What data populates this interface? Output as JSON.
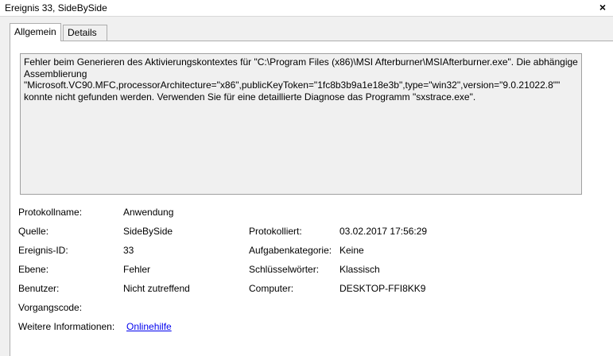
{
  "window": {
    "title": "Ereignis 33, SideBySide",
    "close_label": "×"
  },
  "tabs": [
    {
      "label": "Allgemein"
    },
    {
      "label": "Details"
    }
  ],
  "description": "Fehler beim Generieren des Aktivierungskontextes für \"C:\\Program Files (x86)\\MSI Afterburner\\MSIAfterburner.exe\". Die abhängige\nAssemblierung\n\"Microsoft.VC90.MFC,processorArchitecture=\"x86\",publicKeyToken=\"1fc8b3b9a1e18e3b\",type=\"win32\",version=\"9.0.21022.8\"\"\nkonnte nicht gefunden werden. Verwenden Sie für eine detaillierte Diagnose das Programm \"sxstrace.exe\".",
  "fields": {
    "protokollname": {
      "label": "Protokollname:",
      "value": "Anwendung"
    },
    "quelle": {
      "label": "Quelle:",
      "value": "SideBySide"
    },
    "protokolliert": {
      "label": "Protokolliert:",
      "value": "03.02.2017 17:56:29"
    },
    "ereignis_id": {
      "label": "Ereignis-ID:",
      "value": "33"
    },
    "aufgabenkategorie": {
      "label": "Aufgabenkategorie:",
      "value": "Keine"
    },
    "ebene": {
      "label": "Ebene:",
      "value": "Fehler"
    },
    "schluesselwoerter": {
      "label": "Schlüsselwörter:",
      "value": "Klassisch"
    },
    "benutzer": {
      "label": "Benutzer:",
      "value": "Nicht zutreffend"
    },
    "computer": {
      "label": "Computer:",
      "value": "DESKTOP-FFI8KK9"
    },
    "vorgangscode": {
      "label": "Vorgangscode:",
      "value": ""
    },
    "weitere_informationen": {
      "label": "Weitere Informationen:",
      "link": "Onlinehilfe"
    }
  },
  "colors": {
    "background": "#f0f0f0",
    "panel": "#ffffff",
    "link": "#0000ee"
  }
}
